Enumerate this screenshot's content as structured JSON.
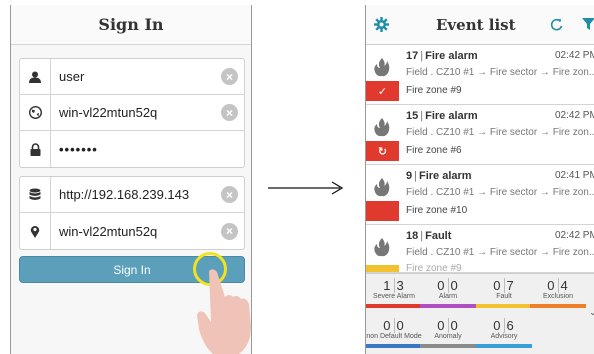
{
  "signin": {
    "title": "Sign In",
    "username": "user",
    "domain": "win-vl22mtun52q",
    "password": "•••••••",
    "server_url": "http://192.168.239.143",
    "location": "win-vl22mtun52q",
    "sign_in_label": "Sign In",
    "clear_glyph": "×"
  },
  "event_list": {
    "title": "Event list",
    "events": [
      {
        "number": "17",
        "type": "Fire alarm",
        "time": "02:42 PM",
        "path": "Field . CZ10 #1 → Fire sector → Fire zon...",
        "zone": "Fire zone #9",
        "status_icon": "check-icon",
        "status_glyph": "✓",
        "status_color": "#e03a2f"
      },
      {
        "number": "15",
        "type": "Fire alarm",
        "time": "02:42 PM",
        "path": "Field . CZ10 #1 → Fire sector → Fire zon...",
        "zone": "Fire zone #6",
        "status_icon": "reset-icon",
        "status_glyph": "↻",
        "status_color": "#e03a2f"
      },
      {
        "number": "9",
        "type": "Fire alarm",
        "time": "02:41 PM",
        "path": "Field . CZ10 #1 → Fire sector → Fire zon...",
        "zone": "Fire zone #10",
        "status_icon": "",
        "status_glyph": "",
        "status_color": "#e03a2f"
      },
      {
        "number": "18",
        "type": "Fault",
        "time": "02:42 PM",
        "path": "Field . CZ10 #1 → Fire sector → Fire zon...",
        "zone": "Fire zone #9",
        "status_icon": "",
        "status_glyph": "",
        "status_color": "#f2c12e"
      }
    ],
    "counters": [
      {
        "digits": [
          "1",
          "3"
        ],
        "label": "Severe Alarm",
        "color": "#e03a2f"
      },
      {
        "digits": [
          "0",
          "0"
        ],
        "label": "Alarm",
        "color": "#b04fc2"
      },
      {
        "digits": [
          "0",
          "7"
        ],
        "label": "Fault",
        "color": "#f2c12e"
      },
      {
        "digits": [
          "0",
          "4"
        ],
        "label": "Exclusion",
        "color": "#f07f2a"
      },
      {
        "digits": [
          "0",
          "0"
        ],
        "label": "non Default Mode",
        "color": "#3a77c9"
      },
      {
        "digits": [
          "0",
          "0"
        ],
        "label": "Anomaly",
        "color": "#8a8a8a"
      },
      {
        "digits": [
          "0",
          "6"
        ],
        "label": "Advisory",
        "color": "#3a9fd8"
      }
    ]
  },
  "colors": {
    "sign_in_button": "#5b9fba",
    "touch_indicator": "#f3e21e",
    "accent_teal": "#1f8fa8"
  }
}
